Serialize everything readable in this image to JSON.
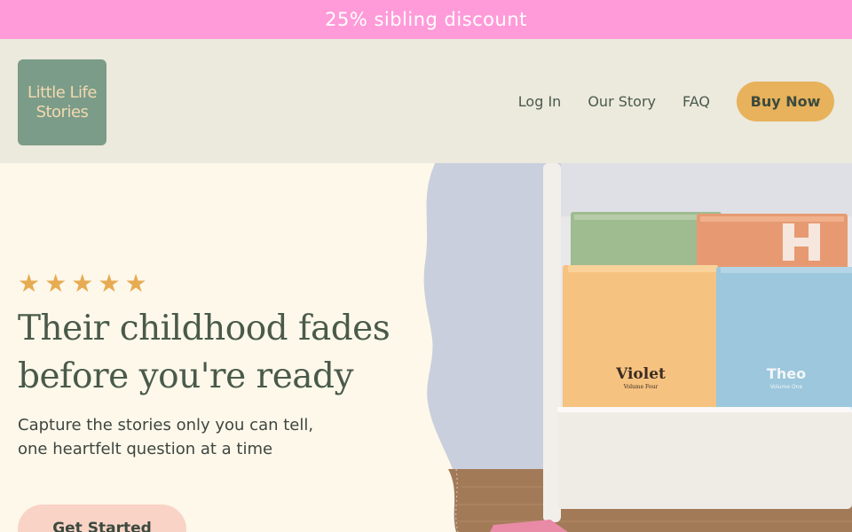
{
  "promo": {
    "text": "25% sibling discount"
  },
  "header": {
    "logo_line1": "Little Life",
    "logo_line2": "Stories",
    "nav": {
      "login": "Log In",
      "story": "Our Story",
      "faq": "FAQ"
    },
    "buy_now": "Buy Now"
  },
  "hero": {
    "rating_stars": 5,
    "headline_line1": "Their childhood fades",
    "headline_line2": "before you're ready",
    "sub_line1": "Capture the stories only you can tell,",
    "sub_line2": "one heartfelt question at a time",
    "cta": "Get Started",
    "book_violet_title": "Violet",
    "book_violet_subtitle": "Volume Four",
    "book_theo_title": "Theo",
    "book_theo_subtitle": "Volume One"
  },
  "colors": {
    "promo_bg": "#ff9bd9",
    "header_bg": "#ece9dd",
    "logo_bg": "#7b9c88",
    "buy_button": "#e7b25b",
    "hero_bg": "#fdf8ea",
    "cta_bg": "#f9d3c6",
    "star": "#e7ab52"
  }
}
